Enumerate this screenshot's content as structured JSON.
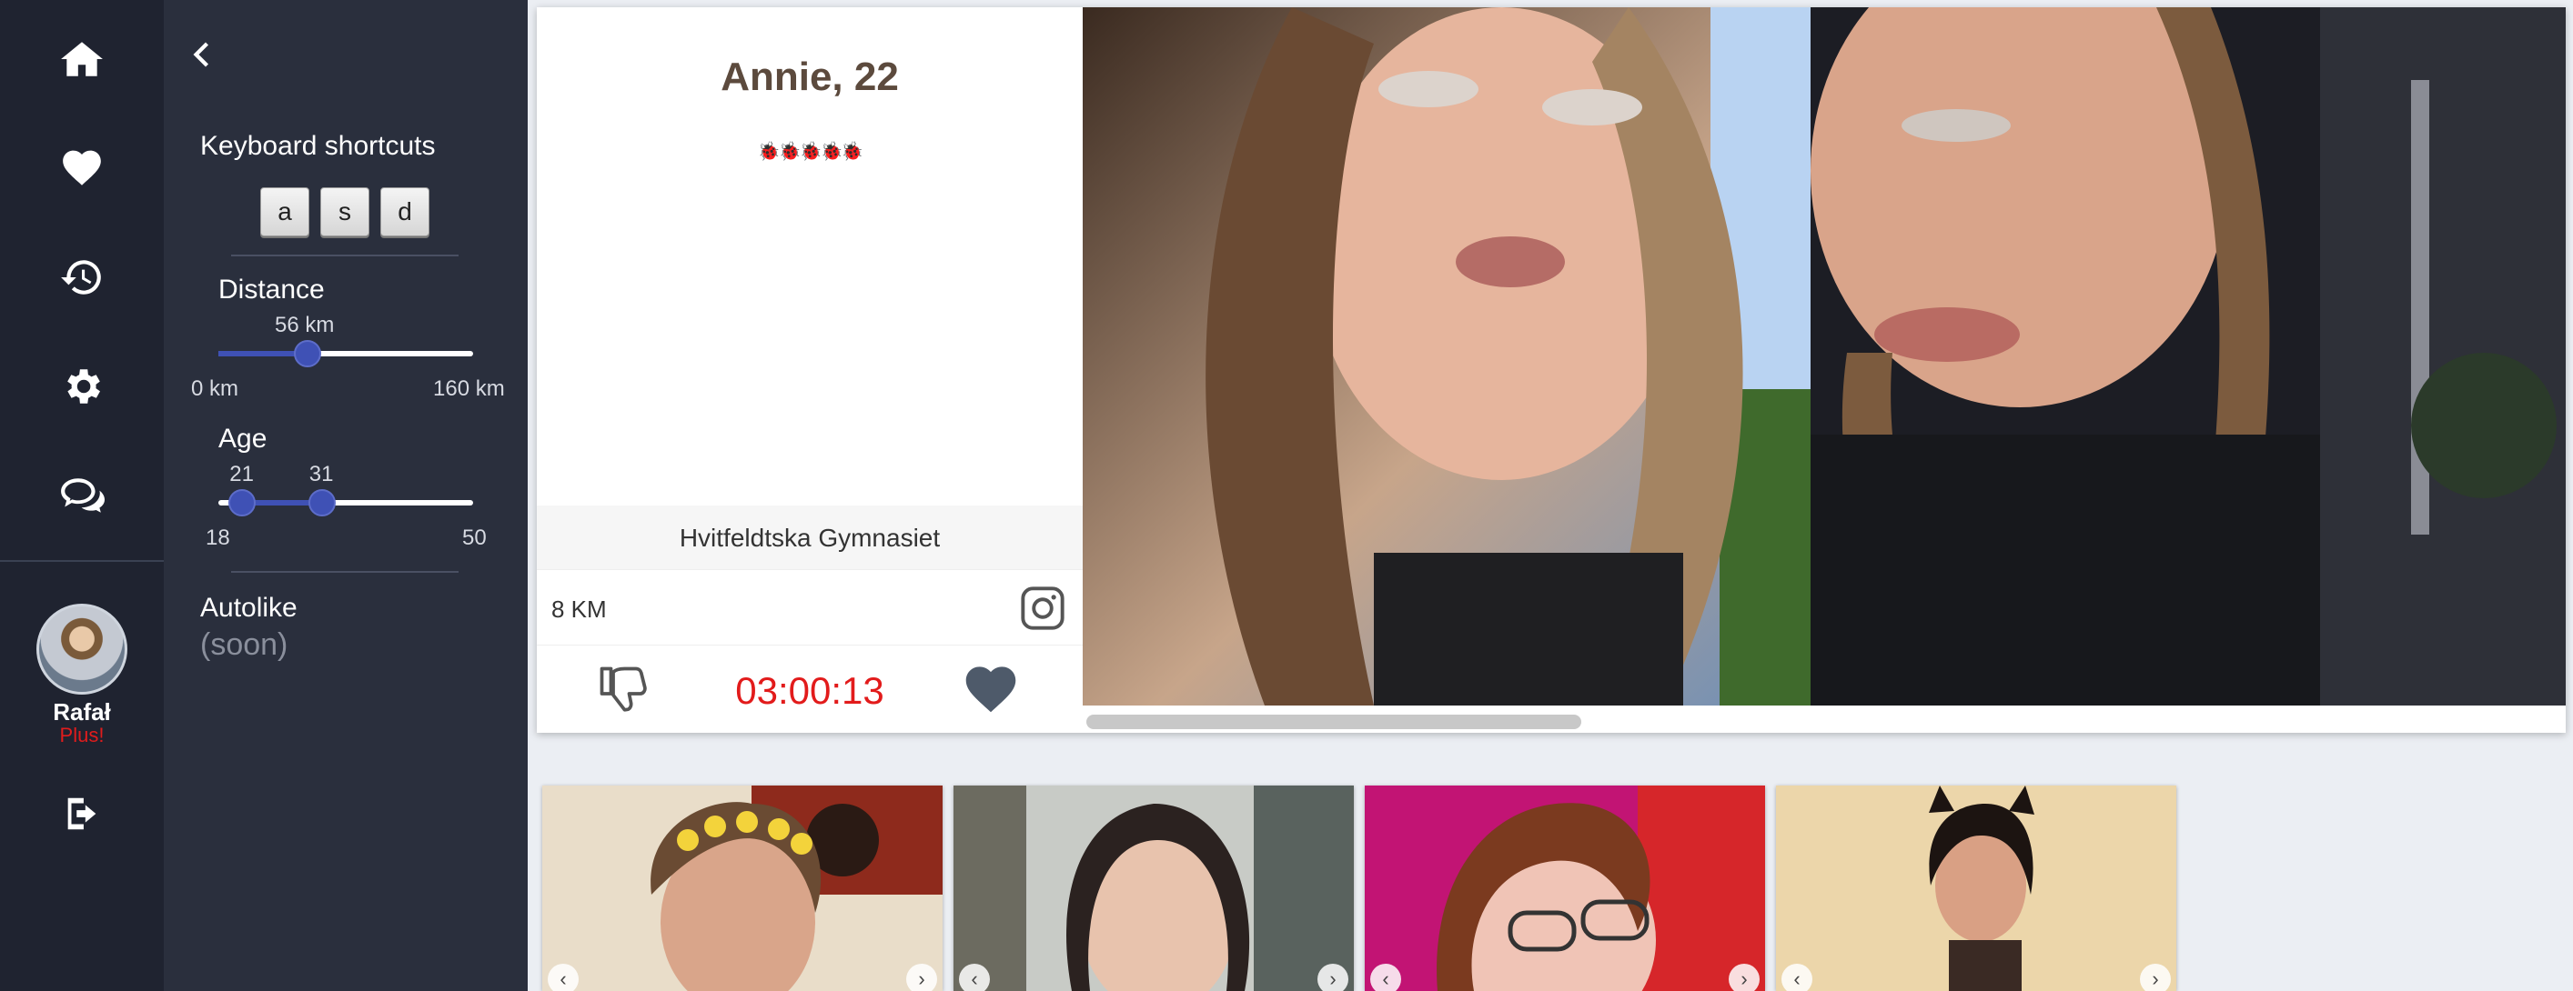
{
  "nav": {
    "items": [
      {
        "name": "home",
        "icon": "home-icon"
      },
      {
        "name": "likes",
        "icon": "heart-icon"
      },
      {
        "name": "history",
        "icon": "history-icon"
      },
      {
        "name": "settings",
        "icon": "gear-icon"
      },
      {
        "name": "messages",
        "icon": "chat-icon"
      }
    ],
    "user": {
      "name": "Rafał",
      "plan": "Plus!"
    },
    "logout_icon": "logout-icon"
  },
  "panel": {
    "back_icon": "chevron-left-icon",
    "shortcuts_title": "Keyboard shortcuts",
    "shortcut_keys": [
      "a",
      "s",
      "d"
    ],
    "distance": {
      "title": "Distance",
      "value_label": "56 km",
      "value": 56,
      "min_label": "0 km",
      "max_label": "160 km",
      "min": 0,
      "max": 160
    },
    "age": {
      "title": "Age",
      "low": 21,
      "high": 31,
      "low_label": "21",
      "high_label": "31",
      "min_label": "18",
      "max_label": "50",
      "min": 18,
      "max": 50
    },
    "autolike_title": "Autolike",
    "autolike_note": "(soon)"
  },
  "profile": {
    "name_age": "Annie, 22",
    "badges": "🐞🐞🐞🐞🐞",
    "school": "Hvitfeldtska Gymnasiet",
    "distance": "8 KM",
    "timer": "03:00:13",
    "instagram_icon": "instagram-icon",
    "dislike_icon": "thumbs-down-icon",
    "like_icon": "heart-icon"
  },
  "colors": {
    "accent": "#3f51b5",
    "timer": "#e21b1b",
    "rail": "#1f2330",
    "panel": "#2a2f3d",
    "plan": "#e01c1c"
  }
}
